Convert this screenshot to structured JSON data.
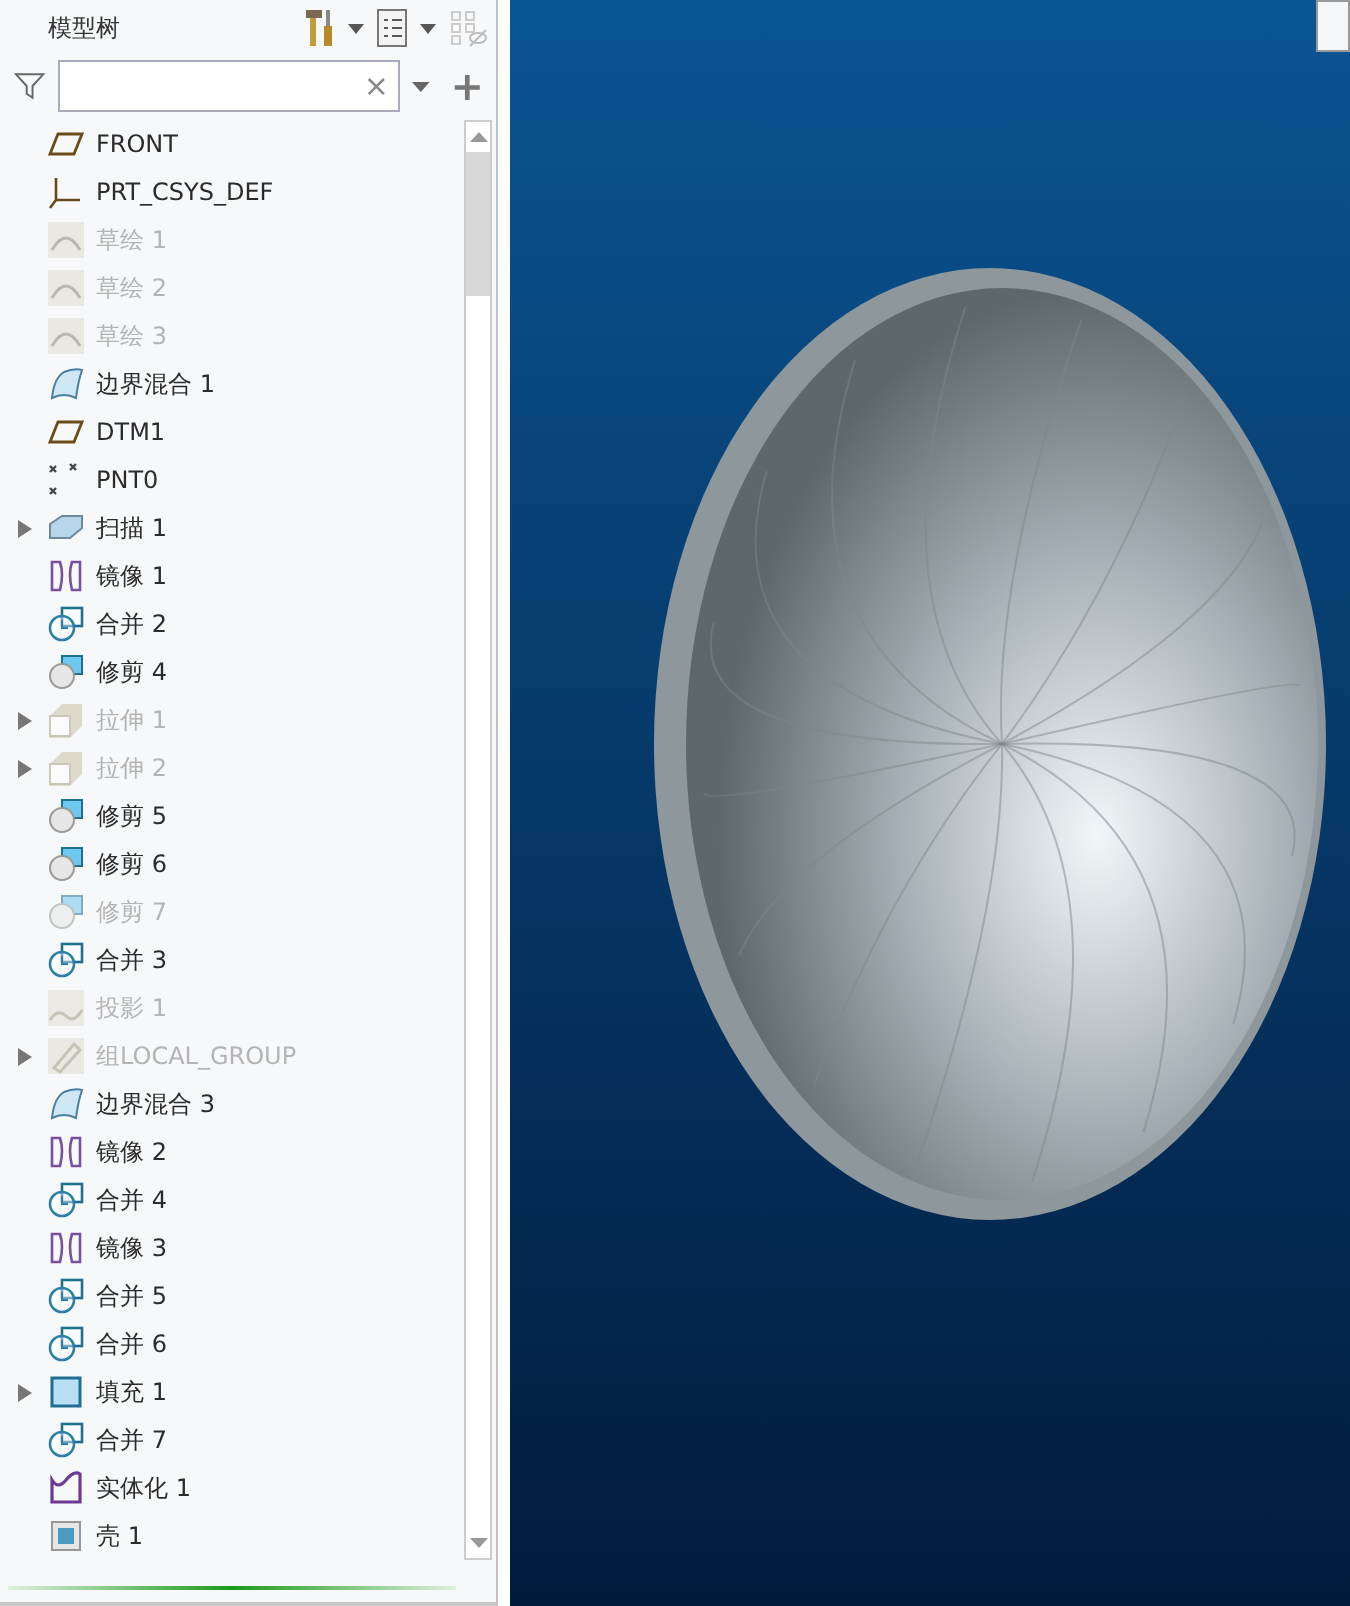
{
  "model_tree": {
    "title": "模型树",
    "filter": {
      "clear": "×",
      "add": "+"
    },
    "items": [
      {
        "label": "FRONT",
        "kind": "plane",
        "suppressed": false,
        "expandable": false
      },
      {
        "label": "PRT_CSYS_DEF",
        "kind": "csys",
        "suppressed": false,
        "expandable": false
      },
      {
        "label": "草绘 1",
        "kind": "sketch",
        "suppressed": true,
        "expandable": false
      },
      {
        "label": "草绘 2",
        "kind": "sketch",
        "suppressed": true,
        "expandable": false
      },
      {
        "label": "草绘 3",
        "kind": "sketch",
        "suppressed": true,
        "expandable": false
      },
      {
        "label": "边界混合 1",
        "kind": "blend",
        "suppressed": false,
        "expandable": false
      },
      {
        "label": "DTM1",
        "kind": "plane",
        "suppressed": false,
        "expandable": false
      },
      {
        "label": "PNT0",
        "kind": "point",
        "suppressed": false,
        "expandable": false
      },
      {
        "label": "扫描 1",
        "kind": "sweep",
        "suppressed": false,
        "expandable": true
      },
      {
        "label": "镜像 1",
        "kind": "mirror",
        "suppressed": false,
        "expandable": false
      },
      {
        "label": "合并 2",
        "kind": "merge",
        "suppressed": false,
        "expandable": false
      },
      {
        "label": "修剪 4",
        "kind": "trim",
        "suppressed": false,
        "expandable": false
      },
      {
        "label": "拉伸 1",
        "kind": "extrude",
        "suppressed": true,
        "expandable": true
      },
      {
        "label": "拉伸 2",
        "kind": "extrude",
        "suppressed": true,
        "expandable": true
      },
      {
        "label": "修剪 5",
        "kind": "trim",
        "suppressed": false,
        "expandable": false
      },
      {
        "label": "修剪 6",
        "kind": "trim",
        "suppressed": false,
        "expandable": false
      },
      {
        "label": "修剪 7",
        "kind": "trim",
        "suppressed": true,
        "expandable": false
      },
      {
        "label": "合并 3",
        "kind": "merge",
        "suppressed": false,
        "expandable": false
      },
      {
        "label": "投影 1",
        "kind": "project",
        "suppressed": true,
        "expandable": false
      },
      {
        "label": "组LOCAL_GROUP",
        "kind": "group",
        "suppressed": true,
        "expandable": true
      },
      {
        "label": "边界混合 3",
        "kind": "blend",
        "suppressed": false,
        "expandable": false
      },
      {
        "label": "镜像 2",
        "kind": "mirror",
        "suppressed": false,
        "expandable": false
      },
      {
        "label": "合并 4",
        "kind": "merge",
        "suppressed": false,
        "expandable": false
      },
      {
        "label": "镜像 3",
        "kind": "mirror",
        "suppressed": false,
        "expandable": false
      },
      {
        "label": "合并 5",
        "kind": "merge",
        "suppressed": false,
        "expandable": false
      },
      {
        "label": "合并 6",
        "kind": "merge",
        "suppressed": false,
        "expandable": false
      },
      {
        "label": "填充 1",
        "kind": "fill",
        "suppressed": false,
        "expandable": true
      },
      {
        "label": "合并 7",
        "kind": "merge",
        "suppressed": false,
        "expandable": false
      },
      {
        "label": "实体化 1",
        "kind": "solidify",
        "suppressed": false,
        "expandable": false
      },
      {
        "label": "壳 1",
        "kind": "shell",
        "suppressed": false,
        "expandable": false
      }
    ]
  }
}
